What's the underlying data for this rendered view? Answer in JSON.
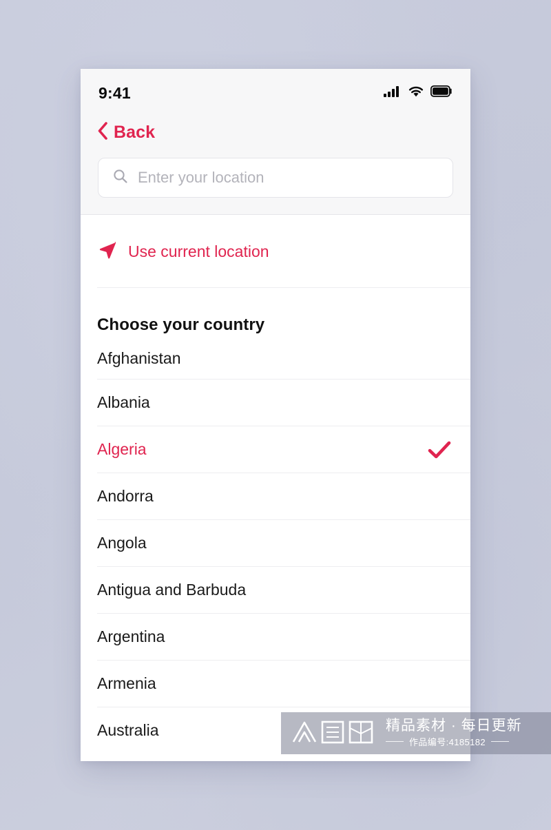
{
  "theme": {
    "accent": "#e0244f",
    "page_background": "#c9ccdd",
    "header_background": "#f7f7f8",
    "divider": "#ededf0",
    "text_primary": "#1a1a1a",
    "placeholder": "#b3b3ba"
  },
  "status_bar": {
    "time": "9:41",
    "icons": [
      "cellular-signal-icon",
      "wifi-icon",
      "battery-icon"
    ]
  },
  "nav": {
    "back_label": "Back",
    "back_icon": "chevron-left-icon"
  },
  "search": {
    "icon": "search-icon",
    "value": "",
    "placeholder": "Enter your location"
  },
  "current_location": {
    "icon": "navigation-arrow-icon",
    "label": "Use current location"
  },
  "section": {
    "title": "Choose your country"
  },
  "countries": [
    {
      "name": "Afghanistan",
      "selected": false
    },
    {
      "name": "Albania",
      "selected": false
    },
    {
      "name": "Algeria",
      "selected": true
    },
    {
      "name": "Andorra",
      "selected": false
    },
    {
      "name": "Angola",
      "selected": false
    },
    {
      "name": "Antigua and Barbuda",
      "selected": false
    },
    {
      "name": "Argentina",
      "selected": false
    },
    {
      "name": "Armenia",
      "selected": false
    },
    {
      "name": "Australia",
      "selected": false
    }
  ],
  "selected_check_icon": "checkmark-icon",
  "watermark": {
    "logo": "zhongtuwang-logo-icon",
    "main_text": "精品素材 · 每日更新",
    "sub_text": "作品编号:4185182"
  }
}
